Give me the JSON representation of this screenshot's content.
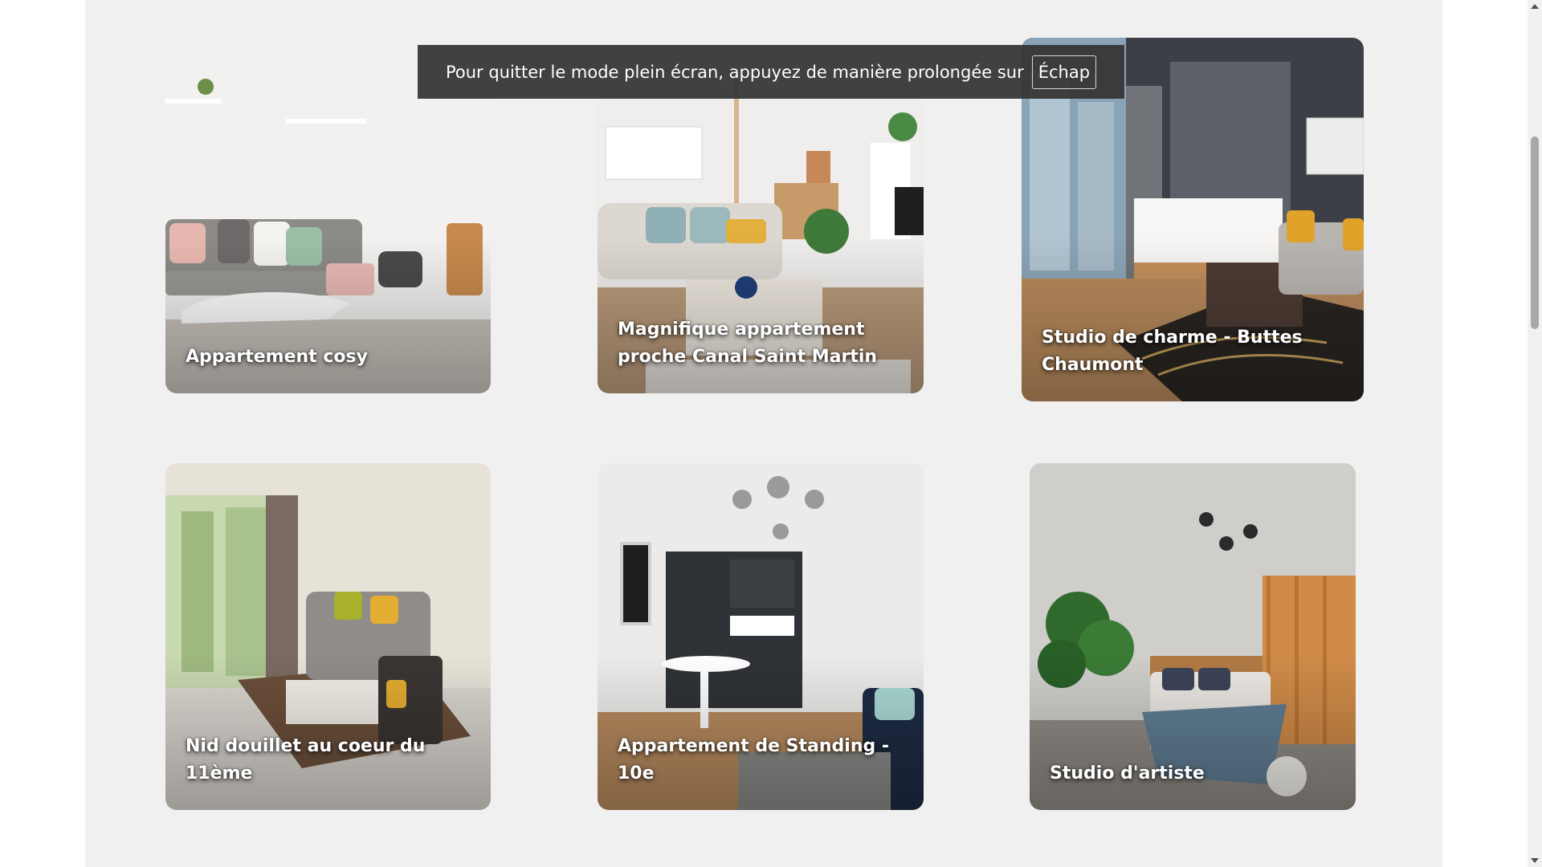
{
  "listings": [
    {
      "title": "Appartement cosy"
    },
    {
      "title": "Magnifique appartement proche Canal Saint Martin"
    },
    {
      "title": "Studio de charme - Buttes Chaumont"
    },
    {
      "title": "Nid douillet au coeur du 11ème"
    },
    {
      "title": "Appartement de Standing - 10e"
    },
    {
      "title": "Studio d'artiste"
    }
  ],
  "fullscreen_notice": {
    "text": "Pour quitter le mode plein écran, appuyez de manière prolongée sur",
    "key": "Échap"
  }
}
